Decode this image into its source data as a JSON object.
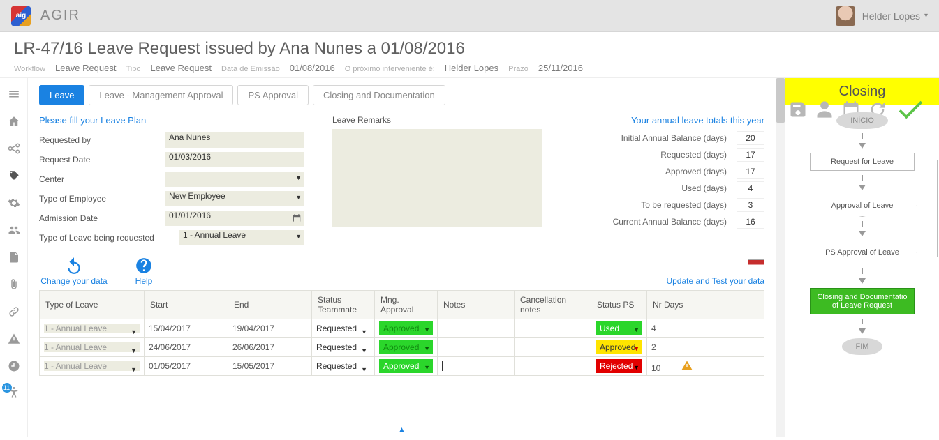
{
  "app": {
    "name": "AGIR"
  },
  "user": {
    "name": "Helder Lopes"
  },
  "page": {
    "title": "LR-47/16 Leave Request issued by Ana Nunes a 01/08/2016",
    "workflow_lbl": "Workflow",
    "workflow_val": "Leave Request",
    "tipo_lbl": "Tipo",
    "tipo_val": "Leave Request",
    "emissao_lbl": "Data de Emissão",
    "emissao_val": "01/08/2016",
    "proximo_lbl": "O próximo interveniente é:",
    "proximo_val": "Helder Lopes",
    "prazo_lbl": "Prazo",
    "prazo_val": "25/11/2016"
  },
  "leftnav": {
    "badge": "11"
  },
  "tabs": {
    "t0": "Leave",
    "t1": "Leave - Management Approval",
    "t2": "PS Approval",
    "t3": "Closing and Documentation"
  },
  "form": {
    "section_title": "Please fill your Leave Plan",
    "requested_by_lbl": "Requested by",
    "requested_by_val": "Ana Nunes",
    "request_date_lbl": "Request Date",
    "request_date_val": "01/03/2016",
    "center_lbl": "Center",
    "center_val": "",
    "type_emp_lbl": "Type of Employee",
    "type_emp_val": "New Employee",
    "admission_lbl": "Admission Date",
    "admission_val": "01/01/2016",
    "type_leave_lbl": "Type of Leave being requested",
    "type_leave_val": "1 - Annual Leave",
    "remarks_lbl": "Leave Remarks"
  },
  "totals": {
    "title": "Your annual leave totals this year",
    "initial_lbl": "Initial Annual Balance (days)",
    "initial_val": "20",
    "requested_lbl": "Requested (days)",
    "requested_val": "17",
    "approved_lbl": "Approved (days)",
    "approved_val": "17",
    "used_lbl": "Used (days)",
    "used_val": "4",
    "tobe_lbl": "To be requested (days)",
    "tobe_val": "3",
    "current_lbl": "Current Annual Balance (days)",
    "current_val": "16"
  },
  "actions": {
    "change": "Change your data",
    "help": "Help",
    "update": "Update and Test your data"
  },
  "grid": {
    "h0": "Type of Leave",
    "h1": "Start",
    "h2": "End",
    "h3": "Status Teammate",
    "h4": "Mng. Approval",
    "h5": "Notes",
    "h6": "Cancellation notes",
    "h7": "Status PS",
    "h8": "Nr Days",
    "r0": {
      "type": "1 - Annual Leave",
      "start": "15/04/2017",
      "end": "19/04/2017",
      "team": "Requested",
      "mng": "Approved",
      "notes": "",
      "cancel": "",
      "ps": "Used",
      "days": "4"
    },
    "r1": {
      "type": "1 - Annual Leave",
      "start": "24/06/2017",
      "end": "26/06/2017",
      "team": "Requested",
      "mng": "Approved",
      "notes": "",
      "cancel": "",
      "ps": "Approved",
      "days": "2"
    },
    "r2": {
      "type": "1 - Annual Leave",
      "start": "01/05/2017",
      "end": "15/05/2017",
      "team": "Requested",
      "mng": "Approved",
      "notes": "",
      "cancel": "",
      "ps": "Rejected",
      "days": "10"
    }
  },
  "workflow": {
    "header": "Closing",
    "n_start": "INÍCIO",
    "n_req": "Request for Leave",
    "n_appr": "Approval of Leave",
    "n_ps": "PS Approval of Leave",
    "n_close": "Closing and Documentatio of Leave Request",
    "n_end": "FIM"
  }
}
